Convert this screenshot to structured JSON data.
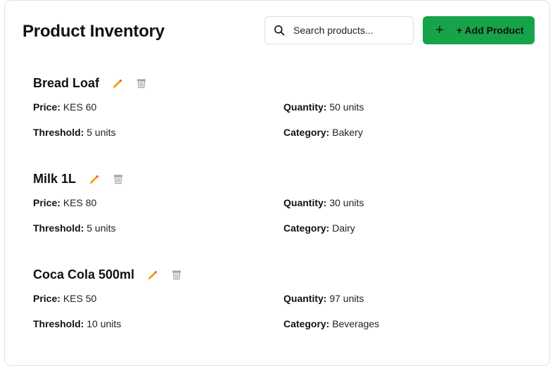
{
  "header": {
    "title": "Product Inventory",
    "search_placeholder": "Search products...",
    "search_icon": "search-icon",
    "add_button_icon": "+",
    "add_button_label": "+ Add Product"
  },
  "colors": {
    "accent": "#16a34a",
    "edit_icon": "#f97316",
    "delete_icon": "#9ca3af"
  },
  "field_labels": {
    "price": "Price:",
    "quantity": "Quantity:",
    "threshold": "Threshold:",
    "category": "Category:"
  },
  "products": [
    {
      "name": "Bread Loaf",
      "price": "KES 60",
      "quantity": "50 units",
      "threshold": "5 units",
      "category": "Bakery"
    },
    {
      "name": "Milk 1L",
      "price": "KES 80",
      "quantity": "30 units",
      "threshold": "5 units",
      "category": "Dairy"
    },
    {
      "name": "Coca Cola 500ml",
      "price": "KES 50",
      "quantity": "97 units",
      "threshold": "10 units",
      "category": "Beverages"
    }
  ]
}
